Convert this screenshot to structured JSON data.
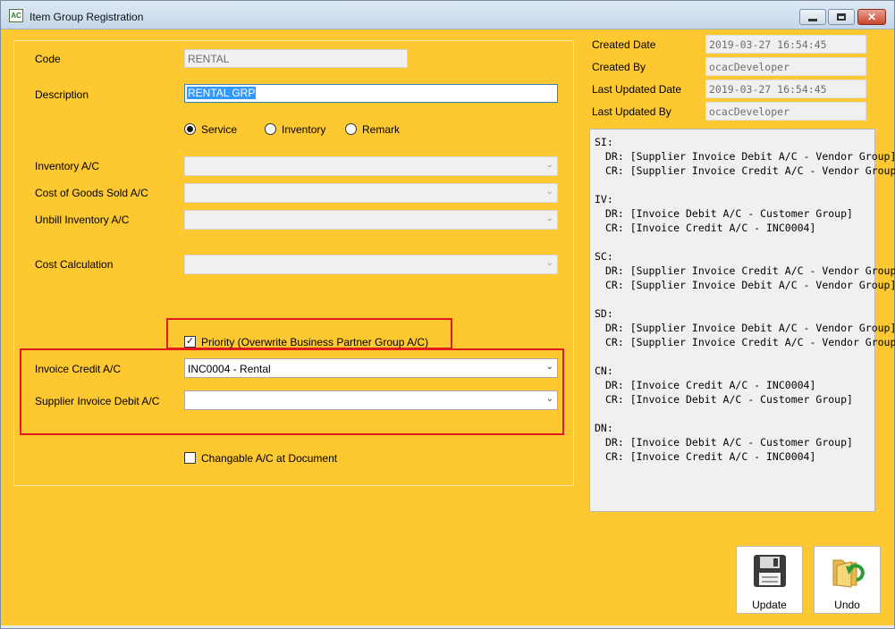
{
  "window": {
    "title": "Item Group Registration",
    "app_icon_text": "AC"
  },
  "form": {
    "code_label": "Code",
    "code_value": "RENTAL",
    "description_label": "Description",
    "description_value": "RENTAL GRP",
    "type_options": [
      "Service",
      "Inventory",
      "Remark"
    ],
    "type_selected": "Service",
    "inventory_ac_label": "Inventory A/C",
    "cogs_ac_label": "Cost of Goods Sold A/C",
    "unbill_inventory_ac_label": "Unbill Inventory A/C",
    "cost_calculation_label": "Cost Calculation",
    "priority_label": "Priority (Overwrite Business Partner Group A/C)",
    "priority_checked": true,
    "invoice_credit_label": "Invoice Credit A/C",
    "invoice_credit_value": "INC0004 - Rental",
    "supplier_invoice_debit_label": "Supplier Invoice Debit A/C",
    "supplier_invoice_debit_value": "",
    "changable_label": "Changable A/C at Document",
    "changable_checked": false
  },
  "meta": {
    "created_date_label": "Created Date",
    "created_date_value": "2019-03-27 16:54:45",
    "created_by_label": "Created By",
    "created_by_value": "ocacDeveloper",
    "last_updated_date_label": "Last Updated Date",
    "last_updated_date_value": "2019-03-27 16:54:45",
    "last_updated_by_label": "Last Updated By",
    "last_updated_by_value": "ocacDeveloper"
  },
  "accounts": [
    {
      "code": "SI:",
      "dr": "DR: [Supplier Invoice Debit A/C - Vendor Group]",
      "cr": "CR: [Supplier Invoice Credit A/C - Vendor Group]"
    },
    {
      "code": "IV:",
      "dr": "DR: [Invoice Debit A/C - Customer Group]",
      "cr": "CR: [Invoice Credit A/C - INC0004]"
    },
    {
      "code": "SC:",
      "dr": "DR: [Supplier Invoice Credit A/C - Vendor Group]",
      "cr": "CR: [Supplier Invoice Debit A/C - Vendor Group]"
    },
    {
      "code": "SD:",
      "dr": "DR: [Supplier Invoice Debit A/C - Vendor Group]",
      "cr": "CR: [Supplier Invoice Credit A/C - Vendor Group]"
    },
    {
      "code": "CN:",
      "dr": "DR: [Invoice Credit A/C - INC0004]",
      "cr": "CR: [Invoice Debit A/C - Customer Group]"
    },
    {
      "code": "DN:",
      "dr": "DR: [Invoice Debit A/C - Customer Group]",
      "cr": "CR: [Invoice Credit A/C - INC0004]"
    }
  ],
  "toolbar": {
    "update_label": "Update",
    "undo_label": "Undo"
  },
  "colors": {
    "background": "#fec830",
    "highlight": "#e51b1b",
    "selection": "#3399ff"
  }
}
